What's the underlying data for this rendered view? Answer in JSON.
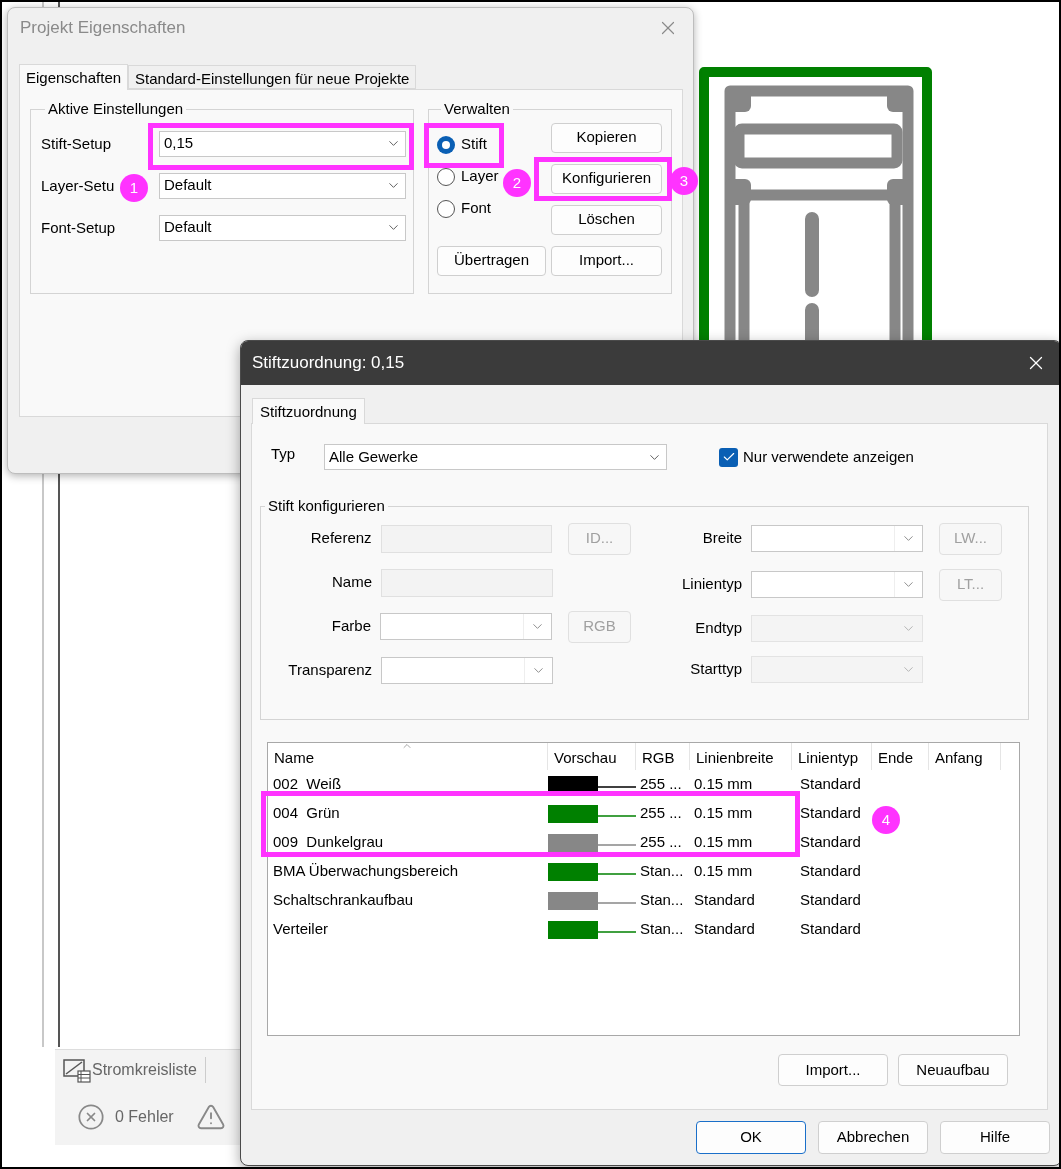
{
  "background": {
    "tabs": [
      {
        "label": "Stromkreisliste"
      }
    ],
    "status": [
      {
        "label": "0 Fehler"
      }
    ]
  },
  "properties_dialog": {
    "title": "Projekt Eigenschaften",
    "tabs": [
      {
        "label": "Eigenschaften",
        "selected": true
      },
      {
        "label": "Standard-Einstellungen für neue Projekte",
        "selected": false
      }
    ],
    "active_settings": {
      "title": "Aktive Einstellungen",
      "rows": [
        {
          "label": "Stift-Setup",
          "value": "0,15"
        },
        {
          "label": "Layer-Setu",
          "value": "Default"
        },
        {
          "label": "Font-Setup",
          "value": "Default"
        }
      ]
    },
    "manage": {
      "title": "Verwalten",
      "options": [
        {
          "label": "Stift",
          "selected": true
        },
        {
          "label": "Layer",
          "selected": false
        },
        {
          "label": "Font",
          "selected": false
        }
      ],
      "side_buttons": [
        "Kopieren",
        "Konfigurieren",
        "Löschen"
      ],
      "bottom_buttons": [
        "Übertragen",
        "Import..."
      ]
    }
  },
  "pen_dialog": {
    "title": "Stiftzuordnung: 0,15",
    "tabs": [
      {
        "label": "Stiftzuordnung",
        "selected": true
      }
    ],
    "type": {
      "label": "Typ",
      "value": "Alle Gewerke"
    },
    "only_used": {
      "label": "Nur verwendete anzeigen",
      "checked": true
    },
    "configure": {
      "title": "Stift konfigurieren",
      "left": [
        {
          "label": "Referenz",
          "kind": "text",
          "disabled": true,
          "button": "ID..."
        },
        {
          "label": "Name",
          "kind": "text",
          "disabled": true
        },
        {
          "label": "Farbe",
          "kind": "combo",
          "disabled": false,
          "button": "RGB"
        },
        {
          "label": "Transparenz",
          "kind": "combo",
          "disabled": false
        }
      ],
      "right": [
        {
          "label": "Breite",
          "kind": "combo",
          "disabled": false,
          "button": "LW..."
        },
        {
          "label": "Linientyp",
          "kind": "combo",
          "disabled": false,
          "button": "LT..."
        },
        {
          "label": "Endtyp",
          "kind": "combo",
          "disabled": true
        },
        {
          "label": "Starttyp",
          "kind": "combo",
          "disabled": true
        }
      ]
    },
    "table": {
      "columns": [
        "Name",
        "Vorschau",
        "RGB",
        "Linienbreite",
        "Linientyp",
        "Ende",
        "Anfang"
      ],
      "rows": [
        {
          "name": "002  Weiß",
          "color": "#000000",
          "rgb": "255 ...",
          "width": "0.15 mm",
          "linetype": "Standard"
        },
        {
          "name": "004  Grün",
          "color": "#008000",
          "rgb": "255 ...",
          "width": "0.15 mm",
          "linetype": "Standard"
        },
        {
          "name": "009  Dunkelgrau",
          "color": "#878787",
          "rgb": "255 ...",
          "width": "0.15 mm",
          "linetype": "Standard"
        },
        {
          "name": "BMA Überwachungsbereich",
          "color": "#008000",
          "rgb": "Stan...",
          "width": "0.15 mm",
          "linetype": "Standard"
        },
        {
          "name": "Schaltschrankaufbau",
          "color": "#878787",
          "rgb": "Stan...",
          "width": "Standard",
          "linetype": "Standard"
        },
        {
          "name": "Verteiler",
          "color": "#008000",
          "rgb": "Stan...",
          "width": "Standard",
          "linetype": "Standard"
        }
      ]
    },
    "list_buttons": [
      "Import...",
      "Neuaufbau"
    ],
    "footer_buttons": [
      {
        "label": "OK",
        "default": true
      },
      {
        "label": "Abbrechen",
        "default": false
      },
      {
        "label": "Hilfe",
        "default": false
      }
    ]
  },
  "annotations": [
    {
      "number": "1"
    },
    {
      "number": "2"
    },
    {
      "number": "3"
    },
    {
      "number": "4"
    }
  ]
}
